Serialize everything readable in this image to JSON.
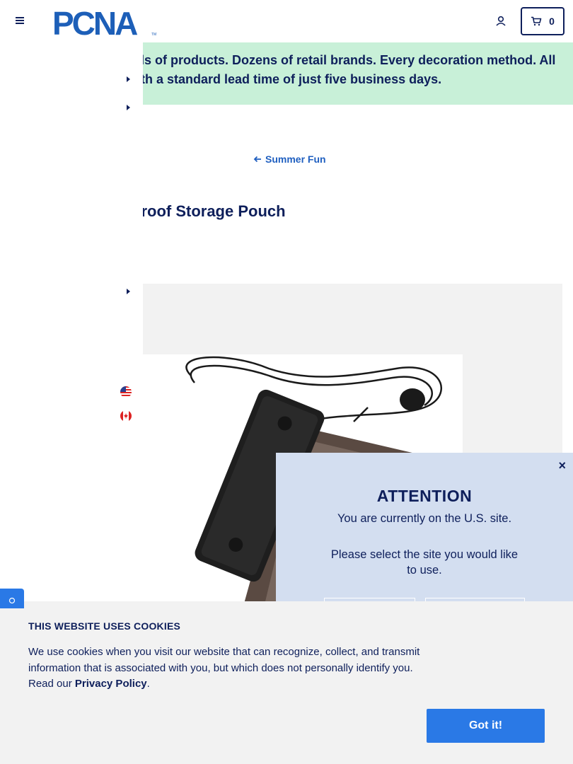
{
  "header": {
    "cart_count": "0",
    "logo_text": "PCNA"
  },
  "banner": {
    "line1": "ls of products. Dozens of retail brands. Every decoration method. All",
    "line2": "th a standard lead time of just five business days."
  },
  "breadcrumb": {
    "back_label": "Summer Fun"
  },
  "product": {
    "title": "proof Storage Pouch"
  },
  "site_modal": {
    "title": "ATTENTION",
    "current_site": "You are currently on the U.S. site.",
    "prompt": "Please select the site you would like to use.",
    "close": "×"
  },
  "cookie_banner": {
    "title": "THIS WEBSITE USES COOKIES",
    "text": "We use cookies when you visit our website that can recognize, collect, and transmit information that is associated with you, but which does not personally identify you. Read our",
    "link": "Privacy Policy",
    "period": ".",
    "button": "Got it!"
  },
  "colors": {
    "navy": "#0e1f5b",
    "banner_bg": "#c8f0d8",
    "accent_blue": "#2a79e6",
    "modal_bg": "#d3def0"
  }
}
